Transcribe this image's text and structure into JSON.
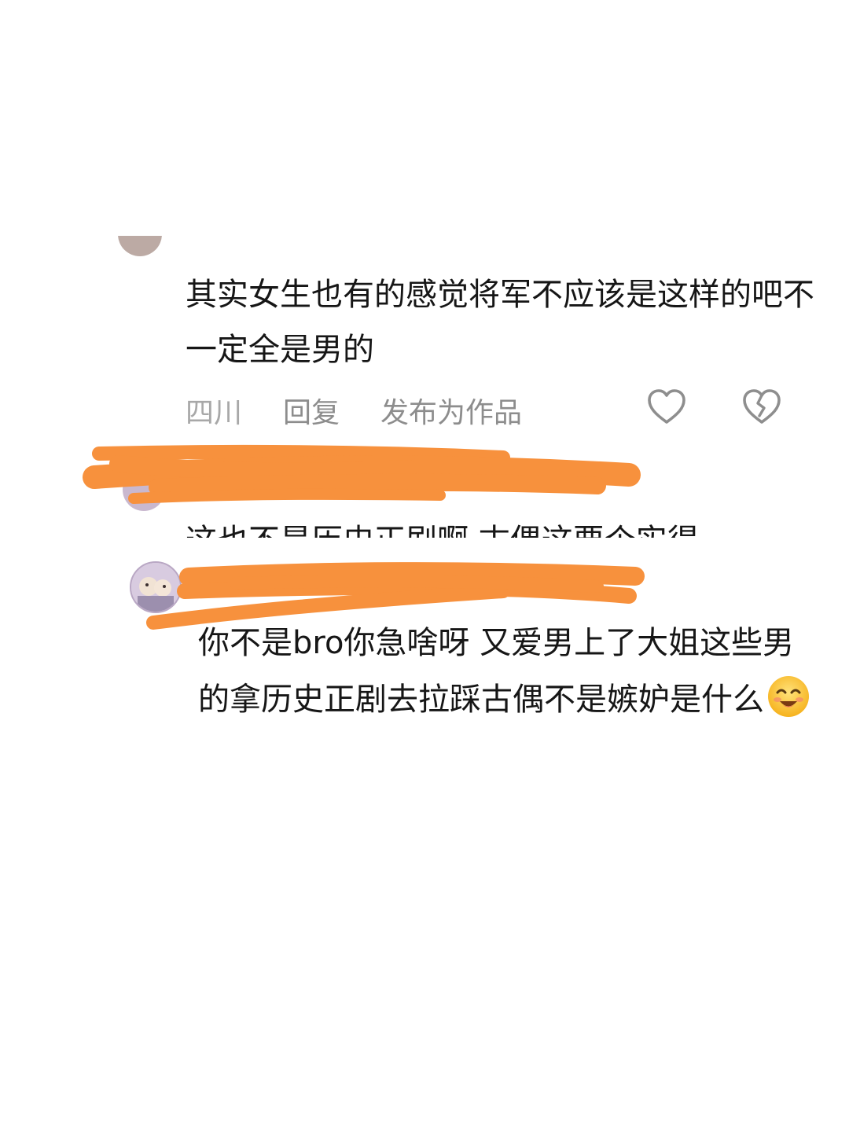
{
  "comments": [
    {
      "text": "其实女生也有的感觉将军不应该是这样的吧不一定全是男的",
      "location": "四川",
      "reply_label": "回复",
      "publish_label": "发布为作品",
      "like_icon": "heart-outline-icon",
      "dislike_icon": "broken-heart-icon"
    },
    {
      "text_partial": "这也不是历史正剧啊 古偶这要个实得"
    },
    {
      "text": "你不是bro你急啥呀 又爱男上了大姐这些男的拿历史正剧去拉踩古偶不是嫉妒是什么",
      "emoji": "smiling-face-icon"
    }
  ],
  "colors": {
    "text": "#161616",
    "meta": "#8d8d8d",
    "redaction": "#f7913d"
  }
}
